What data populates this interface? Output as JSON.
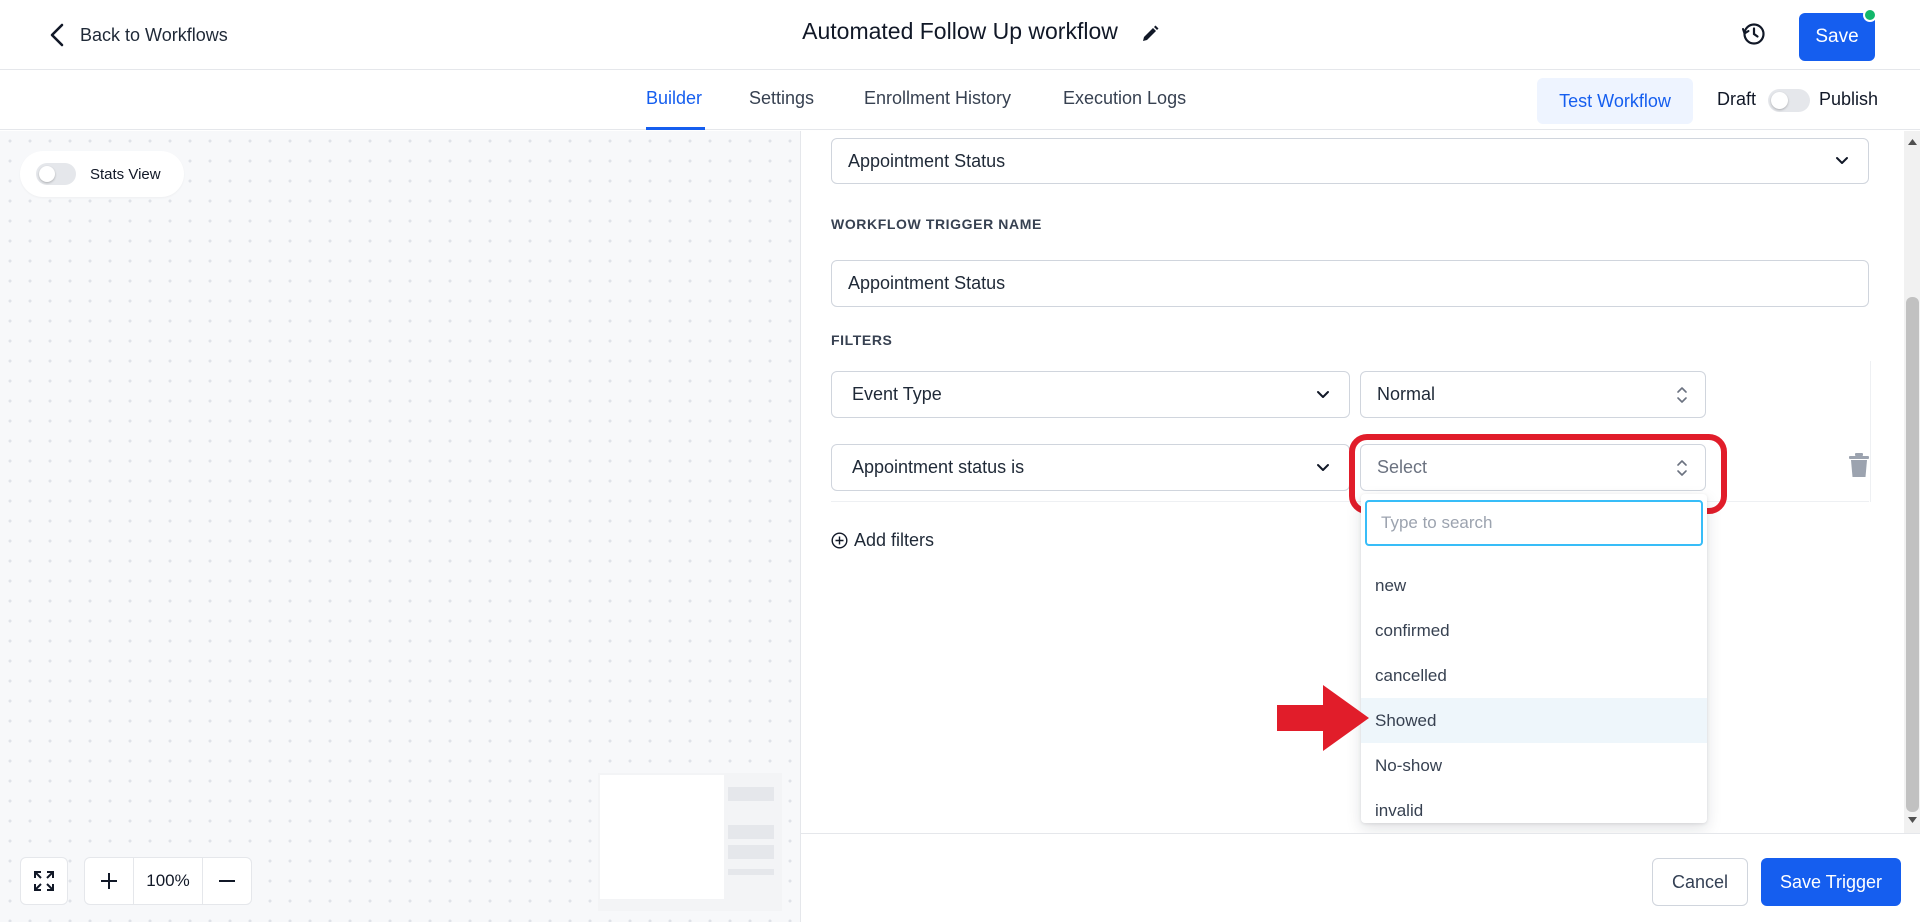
{
  "header": {
    "back_label": "Back to Workflows",
    "title": "Automated Follow Up workflow",
    "save_label": "Save",
    "icons": {
      "back": "chevron-left-icon",
      "edit": "pencil-icon",
      "history": "history-icon"
    }
  },
  "tabs": [
    {
      "label": "Builder",
      "active": true
    },
    {
      "label": "Settings",
      "active": false
    },
    {
      "label": "Enrollment History",
      "active": false
    },
    {
      "label": "Execution Logs",
      "active": false
    }
  ],
  "tabs_right": {
    "test_label": "Test Workflow",
    "draft_label": "Draft",
    "publish_label": "Publish",
    "published": false
  },
  "canvas": {
    "stats_label": "Stats View",
    "stats_on": false,
    "zoom": "100%"
  },
  "trigger_panel": {
    "trigger_type": "Appointment Status",
    "name_label": "WORKFLOW TRIGGER NAME",
    "name_value": "Appointment Status",
    "filters_label": "FILTERS",
    "filters": [
      {
        "field": "Event Type",
        "value": "Normal",
        "placeholder": ""
      },
      {
        "field": "Appointment status is",
        "value": "",
        "placeholder": "Select"
      }
    ],
    "add_filters_label": "Add filters",
    "dropdown": {
      "search_placeholder": "Type to search",
      "options": [
        "new",
        "confirmed",
        "cancelled",
        "Showed",
        "No-show",
        "invalid"
      ],
      "hovered": "Showed"
    },
    "cancel_label": "Cancel",
    "save_trigger_label": "Save Trigger"
  },
  "colors": {
    "primary": "#155eef",
    "annotation_red": "#e11d2a",
    "status_online": "#12b76a",
    "focus_ring": "#38bdf8"
  }
}
